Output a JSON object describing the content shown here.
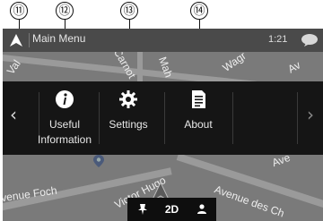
{
  "callouts": [
    "⑪",
    "⑫",
    "⑬",
    "⑭"
  ],
  "status": {
    "title": "Main Menu",
    "time": "1:21"
  },
  "menu": {
    "items": [
      {
        "label_line1": "Useful",
        "label_line2": "Information",
        "icon": "info-icon"
      },
      {
        "label_line1": "Settings",
        "label_line2": "",
        "icon": "gear-icon"
      },
      {
        "label_line1": "About",
        "label_line2": "",
        "icon": "document-icon"
      }
    ]
  },
  "map_labels": {
    "top": [
      "Val",
      "Carnot",
      "Mah",
      "Wagr",
      "Av"
    ],
    "bottom": [
      "venue Foch",
      "Victor Hugo",
      "Avenue des Ch",
      "Ave"
    ]
  },
  "bottom_bar": {
    "view_mode": "2D"
  },
  "colors": {
    "status_bar": "#4a4a4a",
    "menu_panel": "#151515",
    "map": "#7a7a7a",
    "text": "#e8e8e8"
  }
}
